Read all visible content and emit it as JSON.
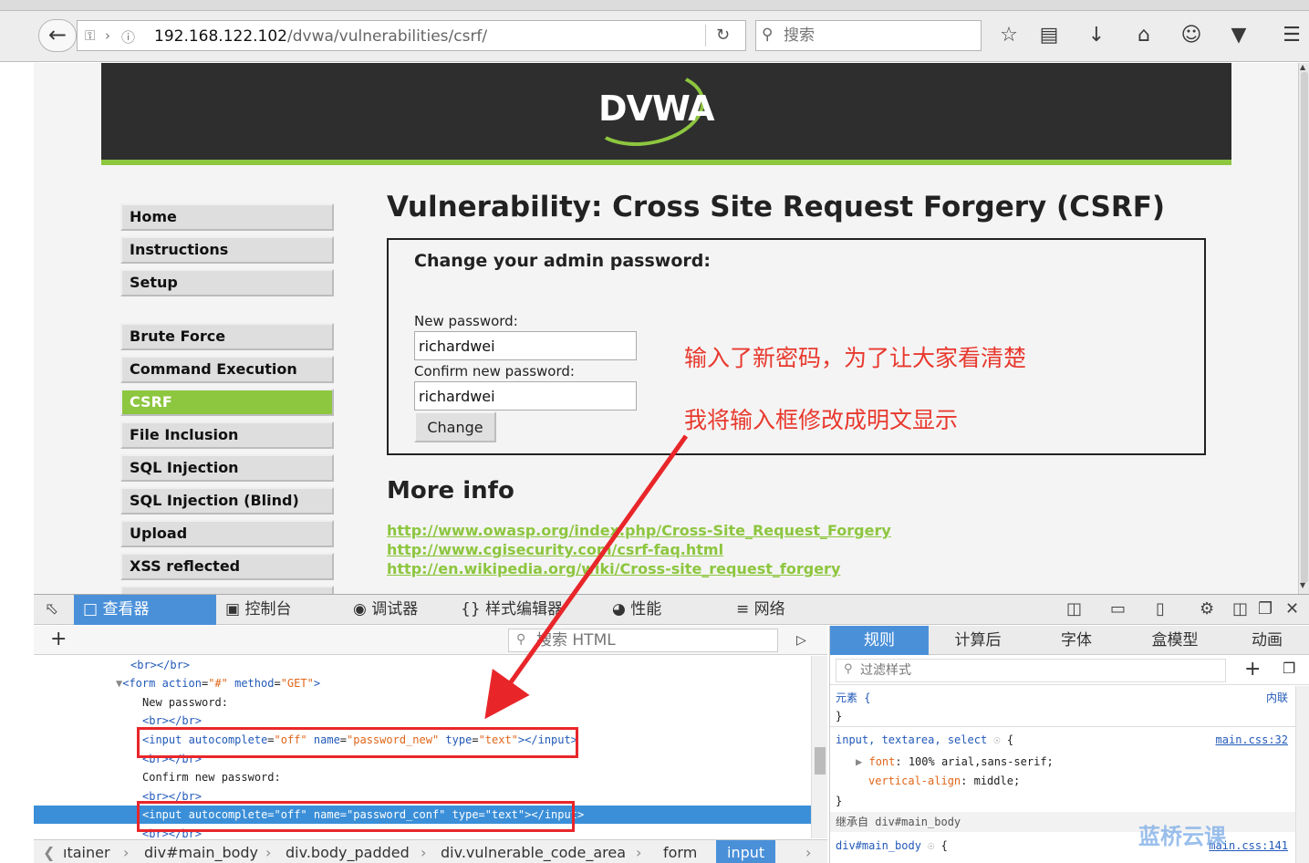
{
  "browser": {
    "url_host": "192.168.122.102",
    "url_path": "/dvwa/vulnerabilities/csrf/",
    "search_placeholder": "搜索"
  },
  "dvwa": {
    "logo": "DVWA",
    "menu": {
      "group1": [
        "Home",
        "Instructions",
        "Setup"
      ],
      "group2": [
        "Brute Force",
        "Command Execution",
        "CSRF",
        "File Inclusion",
        "SQL Injection",
        "SQL Injection (Blind)",
        "Upload",
        "XSS reflected"
      ],
      "active": "CSRF"
    },
    "title": "Vulnerability: Cross Site Request Forgery (CSRF)",
    "form": {
      "heading": "Change your admin password:",
      "new_label": "New password:",
      "new_value": "richardwei",
      "confirm_label": "Confirm new password:",
      "confirm_value": "richardwei",
      "button": "Change"
    },
    "more_info": {
      "heading": "More info",
      "links": [
        "http://www.owasp.org/index.php/Cross-Site_Request_Forgery",
        "http://www.cgisecurity.com/csrf-faq.html",
        "http://en.wikipedia.org/wiki/Cross-site_request_forgery"
      ]
    }
  },
  "annotation": {
    "line1": "输入了新密码，为了让大家看清楚",
    "line2": "我将输入框修改成明文显示",
    "color": "#e8392e"
  },
  "devtools": {
    "tabs": [
      "查看器",
      "控制台",
      "调试器",
      "样式编辑器",
      "性能",
      "网络"
    ],
    "active_tab": "查看器",
    "html_search_placeholder": "搜索 HTML",
    "markup": {
      "br1": "<br></br>",
      "form_tag": "<form",
      "form_attr1": "action",
      "form_val1": "\"#\"",
      "form_attr2": "method",
      "form_val2": "\"GET\"",
      "new_pw_text": "New password:",
      "br2": "<br></br>",
      "input_open": "<input",
      "attr_autocomplete": "autocomplete",
      "val_off": "\"off\"",
      "attr_name": "name",
      "val_pw_new": "\"password_new\"",
      "attr_type": "type",
      "val_text": "\"text\"",
      "input_close": "></input>",
      "br3": "<br></br>",
      "confirm_text": "Confirm new password:",
      "br4": "<br></br>",
      "val_pw_conf": "\"password_conf\"",
      "br5": "<br></br>"
    },
    "breadcrumbs": [
      "ıtainer",
      "div#main_body",
      "div.body_padded",
      "div.vulnerable_code_area",
      "form",
      "input"
    ],
    "rule_tabs": [
      "规则",
      "计算后",
      "字体",
      "盒模型",
      "动画"
    ],
    "active_rule_tab": "规则",
    "filter_placeholder": "过滤样式",
    "rules": {
      "element_selector": "元素 {",
      "element_close": "}",
      "inline_label": "内联",
      "selector2": "input, textarea, select",
      "brace_open": "{",
      "source2": "main.css:32",
      "prop1": "font",
      "val1": "100% arial,sans-serif;",
      "prop2": "vertical-align",
      "val2": "middle;",
      "close2": "}",
      "inherited": "继承自 div#main_body",
      "selector3": "div#main_body",
      "source3": "main.css:141"
    }
  },
  "watermark": "蓝桥云课"
}
